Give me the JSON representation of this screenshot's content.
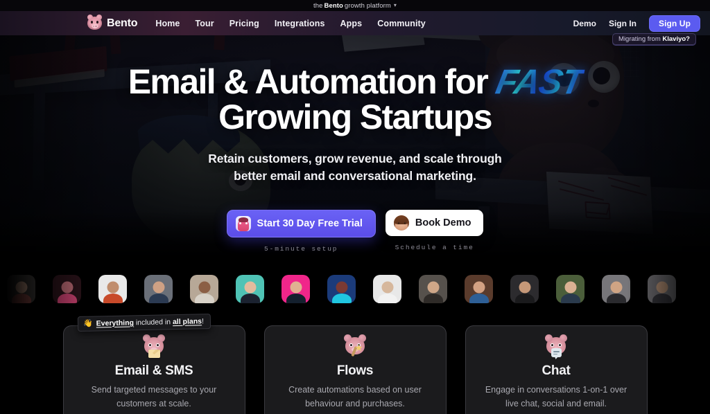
{
  "topbar": {
    "prefix": "the",
    "brand": "Bento",
    "suffix": "growth platform",
    "caret": "chevron-down"
  },
  "nav": {
    "logo_icon": "bento-pig-logo",
    "brand": "Bento",
    "links": [
      {
        "label": "Home"
      },
      {
        "label": "Tour"
      },
      {
        "label": "Pricing"
      },
      {
        "label": "Integrations"
      },
      {
        "label": "Apps"
      },
      {
        "label": "Community"
      }
    ],
    "right": [
      {
        "label": "Demo"
      },
      {
        "label": "Sign In"
      }
    ],
    "signup_label": "Sign Up",
    "signup_color": "#5b5bf0"
  },
  "migrating_badge": {
    "prefix": "Migrating from",
    "brand": "Klaviyo?"
  },
  "hero": {
    "headline_part1": "Email & Automation for",
    "headline_accent": "FAST",
    "headline_part2": "Growing Startups",
    "accent_colors": [
      "#2b6bff",
      "#2fe0e6",
      "#1b4ff5"
    ],
    "subhead_line1": "Retain customers, grow revenue, and scale through",
    "subhead_line2": "better email and conversational marketing.",
    "cta_primary": {
      "label": "Start 30 Day Free Trial",
      "icon": "pink-monster-avatar",
      "note": "5-minute setup"
    },
    "cta_secondary": {
      "label": "Book Demo",
      "icon": "woman-avatar",
      "note": "Schedule a time"
    }
  },
  "avatar_strip": {
    "count": 15,
    "avatars": [
      {
        "name": "customer-avatar-1",
        "bg": "#3d3a38",
        "skin": "#c9a08a",
        "shirt": "#8c4a46"
      },
      {
        "name": "customer-avatar-2",
        "bg": "#241016",
        "skin": "#a05a63",
        "shirt": "#b23a63"
      },
      {
        "name": "customer-avatar-3",
        "bg": "#e9e9e9",
        "skin": "#c08d6d",
        "shirt": "#c84a2a"
      },
      {
        "name": "customer-avatar-4",
        "bg": "#6a6f78",
        "skin": "#cfa184",
        "shirt": "#2b3a52"
      },
      {
        "name": "customer-avatar-5",
        "bg": "#b7a897",
        "skin": "#8b5f45",
        "shirt": "#d8d2c8"
      },
      {
        "name": "customer-avatar-6",
        "bg": "#4fc3b5",
        "skin": "#e2bb9e",
        "shirt": "#1b2230"
      },
      {
        "name": "customer-avatar-7",
        "bg": "#f0268a",
        "skin": "#e0b091",
        "shirt": "#14202e"
      },
      {
        "name": "customer-avatar-8",
        "bg": "#1b3b7a",
        "skin": "#7a3a33",
        "shirt": "#20c6e0"
      },
      {
        "name": "customer-avatar-9",
        "bg": "#e8e8e8",
        "skin": "#d6b79c",
        "shirt": "#f2f2f2"
      },
      {
        "name": "customer-avatar-10",
        "bg": "#56514c",
        "skin": "#cfa788",
        "shirt": "#2f2b28"
      },
      {
        "name": "customer-avatar-11",
        "bg": "#5a3b2c",
        "skin": "#d3a183",
        "shirt": "#2e5f96"
      },
      {
        "name": "customer-avatar-12",
        "bg": "#2c2b2e",
        "skin": "#c59878",
        "shirt": "#1a1a1c"
      },
      {
        "name": "customer-avatar-13",
        "bg": "#4b5e3a",
        "skin": "#dbb193",
        "shirt": "#2a3a4c"
      },
      {
        "name": "customer-avatar-14",
        "bg": "#77767a",
        "skin": "#cfa484",
        "shirt": "#2a2a2e"
      },
      {
        "name": "customer-avatar-15",
        "bg": "#6e6d71",
        "skin": "#b99478",
        "shirt": "#34343a"
      }
    ]
  },
  "plans_badge": {
    "emoji": "👋",
    "strong1": "Everything",
    "middle": " included in ",
    "strong2": "all plans",
    "suffix": "!"
  },
  "cards": [
    {
      "icon": "bear-with-envelope-icon",
      "title": "Email & SMS",
      "desc_line1": "Send targeted messages to your",
      "desc_line2": "customers at scale."
    },
    {
      "icon": "bear-with-magic-wand-icon",
      "title": "Flows",
      "desc_line1": "Create automations based on user",
      "desc_line2": "behaviour and purchases."
    },
    {
      "icon": "bear-with-chat-bubble-icon",
      "title": "Chat",
      "desc_line1": "Engage in conversations 1-on-1 over",
      "desc_line2": "live chat, social and email."
    }
  ]
}
